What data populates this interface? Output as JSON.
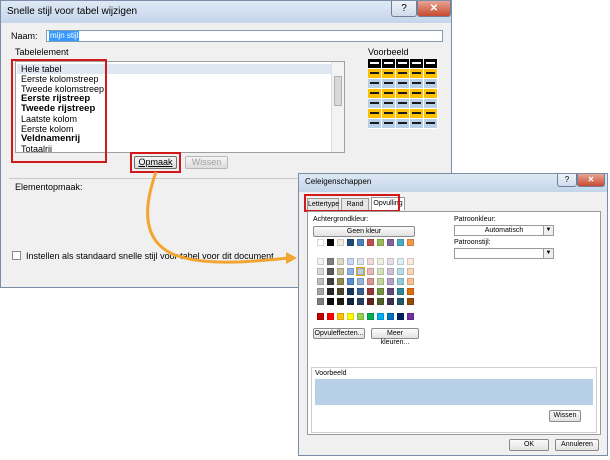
{
  "dialog1": {
    "title": "Snelle stijl voor tabel wijzigen",
    "help": "?",
    "close": "✕",
    "name_label": "Naam:",
    "name_value": "mijn stijl",
    "element_label": "Tabelelement",
    "preview_label": "Voorbeeld",
    "elements": [
      {
        "label": "Hele tabel",
        "bold": false
      },
      {
        "label": "Eerste kolomstreep",
        "bold": false
      },
      {
        "label": "Tweede kolomstreep",
        "bold": false
      },
      {
        "label": "Eerste rijstreep",
        "bold": true
      },
      {
        "label": "Tweede rijstreep",
        "bold": true
      },
      {
        "label": "Laatste kolom",
        "bold": false
      },
      {
        "label": "Eerste kolom",
        "bold": false
      },
      {
        "label": "Veldnamenrij",
        "bold": true
      },
      {
        "label": "Totaalrij",
        "bold": false
      }
    ],
    "format_button": "Opmaak",
    "clear_button": "Wissen",
    "element_format_label": "Elementopmaak:",
    "default_checkbox_label": "Instellen als standaard snelle stijl voor tabel voor dit document"
  },
  "dialog2": {
    "title": "Celeigenschappen",
    "help": "?",
    "close": "✕",
    "tabs": [
      "Lettertype",
      "Rand",
      "Opvulling"
    ],
    "active_tab": "Opvulling",
    "bg_color_label": "Achtergrondkleur:",
    "no_color_button": "Geen kleur",
    "pattern_color_label": "Patroonkleur:",
    "pattern_color_value": "Automatisch",
    "pattern_style_label": "Patroonstijl:",
    "pattern_style_value": "",
    "fill_effects_button": "Opvuleffecten...",
    "more_colors_button": "Meer kleuren...",
    "preview_label": "Voorbeeld",
    "preview_color": "#b8cfe8",
    "clear_button": "Wissen",
    "ok_button": "OK",
    "cancel_button": "Annuleren"
  },
  "colors": {
    "highlight_red": "#d01a1a",
    "arrow_orange": "#f2a531",
    "selection_blue": "#3399ff"
  }
}
